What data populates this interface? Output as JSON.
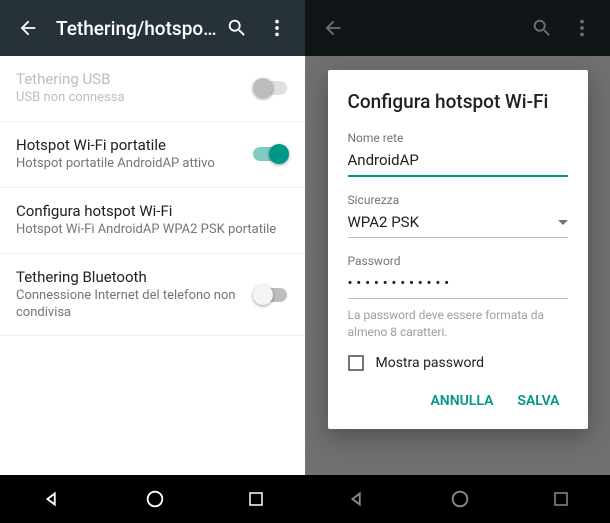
{
  "left": {
    "appbar": {
      "title": "Tethering/hotspot p..."
    },
    "settings": {
      "usb": {
        "title": "Tethering USB",
        "subtitle": "USB non connessa"
      },
      "wifi": {
        "title": "Hotspot Wi-Fi portatile",
        "subtitle": "Hotspot portatile AndroidAP attivo"
      },
      "config": {
        "title": "Configura hotspot Wi-Fi",
        "subtitle": "Hotspot Wi-Fi AndroidAP WPA2 PSK portatile"
      },
      "bt": {
        "title": "Tethering Bluetooth",
        "subtitle": "Connessione Internet del telefono non condivisa"
      }
    }
  },
  "right": {
    "appbar": {
      "title": ""
    },
    "dialog": {
      "title": "Configura hotspot Wi-Fi",
      "network_label": "Nome rete",
      "network_value": "AndroidAP",
      "security_label": "Sicurezza",
      "security_value": "WPA2 PSK",
      "password_label": "Password",
      "password_value": "• • • • • • • • • • • •",
      "hint": "La password deve essere formata da almeno 8 caratteri.",
      "show_password": "Mostra password",
      "cancel": "ANNULLA",
      "save": "SALVA"
    }
  }
}
